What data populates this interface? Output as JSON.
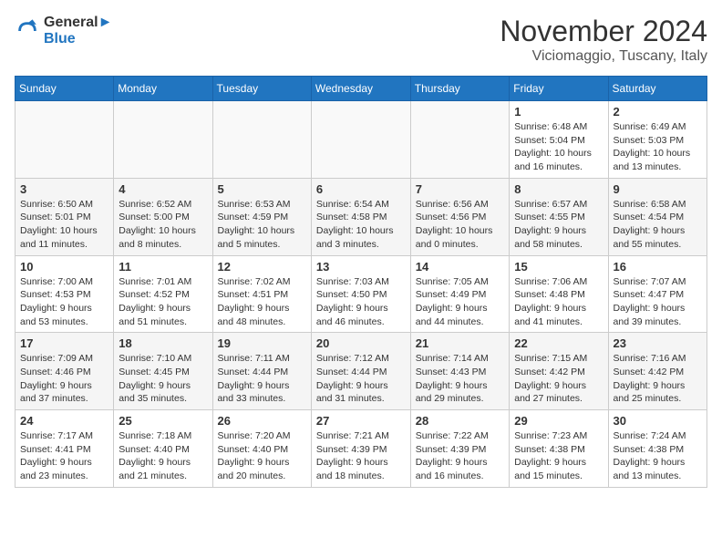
{
  "header": {
    "logo_line1": "General",
    "logo_line2": "Blue",
    "month": "November 2024",
    "location": "Viciomaggio, Tuscany, Italy"
  },
  "weekdays": [
    "Sunday",
    "Monday",
    "Tuesday",
    "Wednesday",
    "Thursday",
    "Friday",
    "Saturday"
  ],
  "weeks": [
    [
      {
        "day": "",
        "info": ""
      },
      {
        "day": "",
        "info": ""
      },
      {
        "day": "",
        "info": ""
      },
      {
        "day": "",
        "info": ""
      },
      {
        "day": "",
        "info": ""
      },
      {
        "day": "1",
        "info": "Sunrise: 6:48 AM\nSunset: 5:04 PM\nDaylight: 10 hours\nand 16 minutes."
      },
      {
        "day": "2",
        "info": "Sunrise: 6:49 AM\nSunset: 5:03 PM\nDaylight: 10 hours\nand 13 minutes."
      }
    ],
    [
      {
        "day": "3",
        "info": "Sunrise: 6:50 AM\nSunset: 5:01 PM\nDaylight: 10 hours\nand 11 minutes."
      },
      {
        "day": "4",
        "info": "Sunrise: 6:52 AM\nSunset: 5:00 PM\nDaylight: 10 hours\nand 8 minutes."
      },
      {
        "day": "5",
        "info": "Sunrise: 6:53 AM\nSunset: 4:59 PM\nDaylight: 10 hours\nand 5 minutes."
      },
      {
        "day": "6",
        "info": "Sunrise: 6:54 AM\nSunset: 4:58 PM\nDaylight: 10 hours\nand 3 minutes."
      },
      {
        "day": "7",
        "info": "Sunrise: 6:56 AM\nSunset: 4:56 PM\nDaylight: 10 hours\nand 0 minutes."
      },
      {
        "day": "8",
        "info": "Sunrise: 6:57 AM\nSunset: 4:55 PM\nDaylight: 9 hours\nand 58 minutes."
      },
      {
        "day": "9",
        "info": "Sunrise: 6:58 AM\nSunset: 4:54 PM\nDaylight: 9 hours\nand 55 minutes."
      }
    ],
    [
      {
        "day": "10",
        "info": "Sunrise: 7:00 AM\nSunset: 4:53 PM\nDaylight: 9 hours\nand 53 minutes."
      },
      {
        "day": "11",
        "info": "Sunrise: 7:01 AM\nSunset: 4:52 PM\nDaylight: 9 hours\nand 51 minutes."
      },
      {
        "day": "12",
        "info": "Sunrise: 7:02 AM\nSunset: 4:51 PM\nDaylight: 9 hours\nand 48 minutes."
      },
      {
        "day": "13",
        "info": "Sunrise: 7:03 AM\nSunset: 4:50 PM\nDaylight: 9 hours\nand 46 minutes."
      },
      {
        "day": "14",
        "info": "Sunrise: 7:05 AM\nSunset: 4:49 PM\nDaylight: 9 hours\nand 44 minutes."
      },
      {
        "day": "15",
        "info": "Sunrise: 7:06 AM\nSunset: 4:48 PM\nDaylight: 9 hours\nand 41 minutes."
      },
      {
        "day": "16",
        "info": "Sunrise: 7:07 AM\nSunset: 4:47 PM\nDaylight: 9 hours\nand 39 minutes."
      }
    ],
    [
      {
        "day": "17",
        "info": "Sunrise: 7:09 AM\nSunset: 4:46 PM\nDaylight: 9 hours\nand 37 minutes."
      },
      {
        "day": "18",
        "info": "Sunrise: 7:10 AM\nSunset: 4:45 PM\nDaylight: 9 hours\nand 35 minutes."
      },
      {
        "day": "19",
        "info": "Sunrise: 7:11 AM\nSunset: 4:44 PM\nDaylight: 9 hours\nand 33 minutes."
      },
      {
        "day": "20",
        "info": "Sunrise: 7:12 AM\nSunset: 4:44 PM\nDaylight: 9 hours\nand 31 minutes."
      },
      {
        "day": "21",
        "info": "Sunrise: 7:14 AM\nSunset: 4:43 PM\nDaylight: 9 hours\nand 29 minutes."
      },
      {
        "day": "22",
        "info": "Sunrise: 7:15 AM\nSunset: 4:42 PM\nDaylight: 9 hours\nand 27 minutes."
      },
      {
        "day": "23",
        "info": "Sunrise: 7:16 AM\nSunset: 4:42 PM\nDaylight: 9 hours\nand 25 minutes."
      }
    ],
    [
      {
        "day": "24",
        "info": "Sunrise: 7:17 AM\nSunset: 4:41 PM\nDaylight: 9 hours\nand 23 minutes."
      },
      {
        "day": "25",
        "info": "Sunrise: 7:18 AM\nSunset: 4:40 PM\nDaylight: 9 hours\nand 21 minutes."
      },
      {
        "day": "26",
        "info": "Sunrise: 7:20 AM\nSunset: 4:40 PM\nDaylight: 9 hours\nand 20 minutes."
      },
      {
        "day": "27",
        "info": "Sunrise: 7:21 AM\nSunset: 4:39 PM\nDaylight: 9 hours\nand 18 minutes."
      },
      {
        "day": "28",
        "info": "Sunrise: 7:22 AM\nSunset: 4:39 PM\nDaylight: 9 hours\nand 16 minutes."
      },
      {
        "day": "29",
        "info": "Sunrise: 7:23 AM\nSunset: 4:38 PM\nDaylight: 9 hours\nand 15 minutes."
      },
      {
        "day": "30",
        "info": "Sunrise: 7:24 AM\nSunset: 4:38 PM\nDaylight: 9 hours\nand 13 minutes."
      }
    ]
  ]
}
